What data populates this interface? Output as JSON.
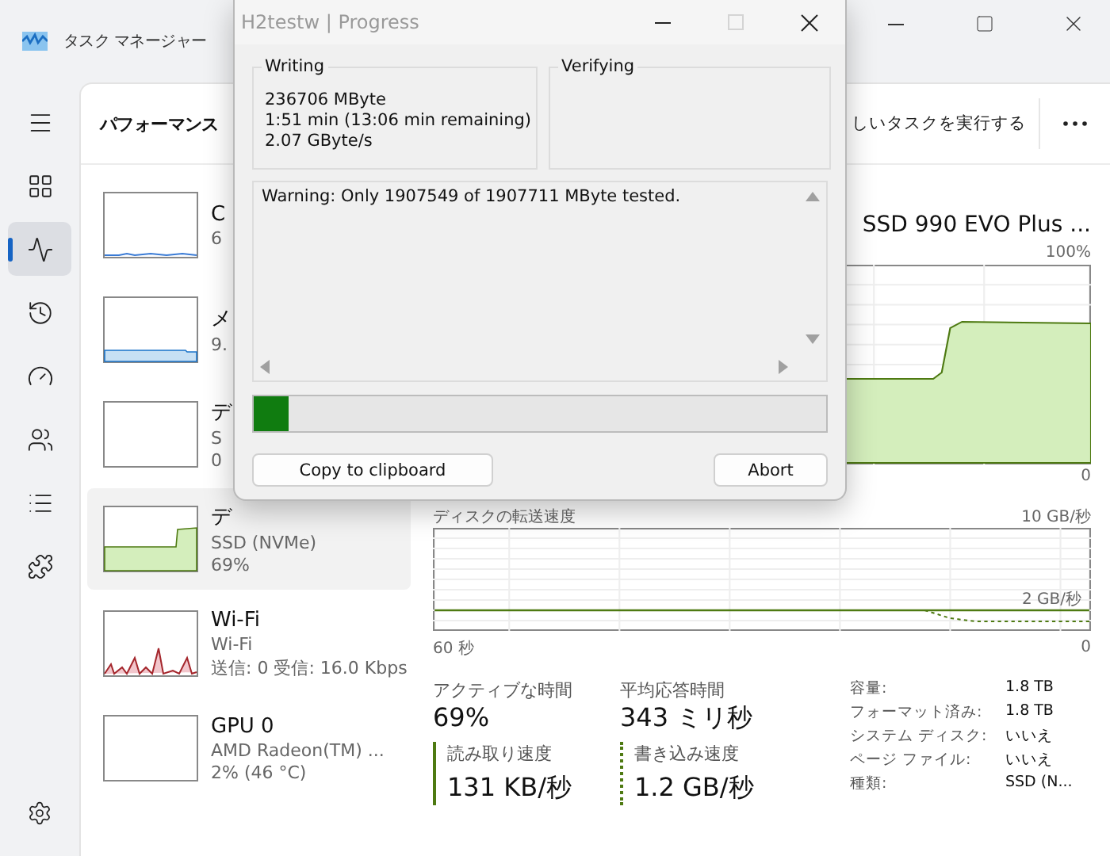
{
  "task_manager": {
    "title": "タスク マネージャー",
    "nav": [
      {
        "selected": false
      },
      {
        "selected": false
      },
      {
        "selected": true
      },
      {
        "selected": false
      },
      {
        "selected": false
      },
      {
        "selected": false
      },
      {
        "selected": false
      },
      {
        "selected": false
      }
    ],
    "page_title": "パフォーマンス",
    "run_task": "しいタスクを実行する",
    "devices": [
      {
        "name": "C",
        "lines": [
          "6"
        ],
        "kind": "cpu",
        "selected": false
      },
      {
        "name": "メ",
        "lines": [
          "9."
        ],
        "kind": "memory",
        "selected": false
      },
      {
        "name": "デ",
        "lines": [
          "S",
          "0"
        ],
        "kind": "idle",
        "selected": false
      },
      {
        "name": "デ",
        "lines": [
          "SSD (NVMe)",
          "69%"
        ],
        "kind": "disk",
        "selected": true
      },
      {
        "name": "Wi-Fi",
        "lines": [
          "Wi-Fi",
          "送信: 0 受信: 16.0 Kbps"
        ],
        "kind": "network",
        "selected": false
      },
      {
        "name": "GPU 0",
        "lines": [
          "AMD Radeon(TM) ...",
          "2% (46 °C)"
        ],
        "kind": "idle",
        "selected": false
      }
    ],
    "detail": {
      "device": "SSD 990 EVO Plus ...",
      "graph_max": "100%",
      "graph_min": "0",
      "transfer_label": "ディスクの転送速度",
      "transfer_max": "10 GB/秒",
      "transfer_mid": "2 GB/秒",
      "time_start": "60 秒",
      "time_end": "0",
      "stats": [
        {
          "label": "アクティブな時間",
          "value": "69%"
        },
        {
          "label": "平均応答時間",
          "value": "343 ミリ秒"
        }
      ],
      "speeds": [
        {
          "label": "読み取り速度",
          "value": "131 KB/秒",
          "kind": "read"
        },
        {
          "label": "書き込み速度",
          "value": "1.2 GB/秒",
          "kind": "write"
        }
      ],
      "info": [
        {
          "label": "容量:",
          "value": "1.8 TB"
        },
        {
          "label": "フォーマット済み:",
          "value": "1.8 TB"
        },
        {
          "label": "システム ディスク:",
          "value": "いいえ"
        },
        {
          "label": "ページ ファイル:",
          "value": "いいえ"
        },
        {
          "label": "種類:",
          "value": "SSD (N..."
        }
      ]
    }
  },
  "dialog": {
    "title": "H2testw | Progress",
    "controls": [
      {
        "kind": "minimize",
        "disabled": false
      },
      {
        "kind": "maximize",
        "disabled": true
      },
      {
        "kind": "close",
        "disabled": false
      }
    ],
    "groups": [
      {
        "title": "Writing",
        "lines": [
          "236706 MByte",
          "1:51 min (13:06 min remaining)",
          "2.07 GByte/s"
        ]
      },
      {
        "title": "Verifying"
      }
    ],
    "log": "Warning: Only 1907549 of 1907711 MByte tested.",
    "progress": {
      "level": 0.06
    },
    "buttons": [
      "Copy to clipboard",
      "Abort"
    ]
  }
}
